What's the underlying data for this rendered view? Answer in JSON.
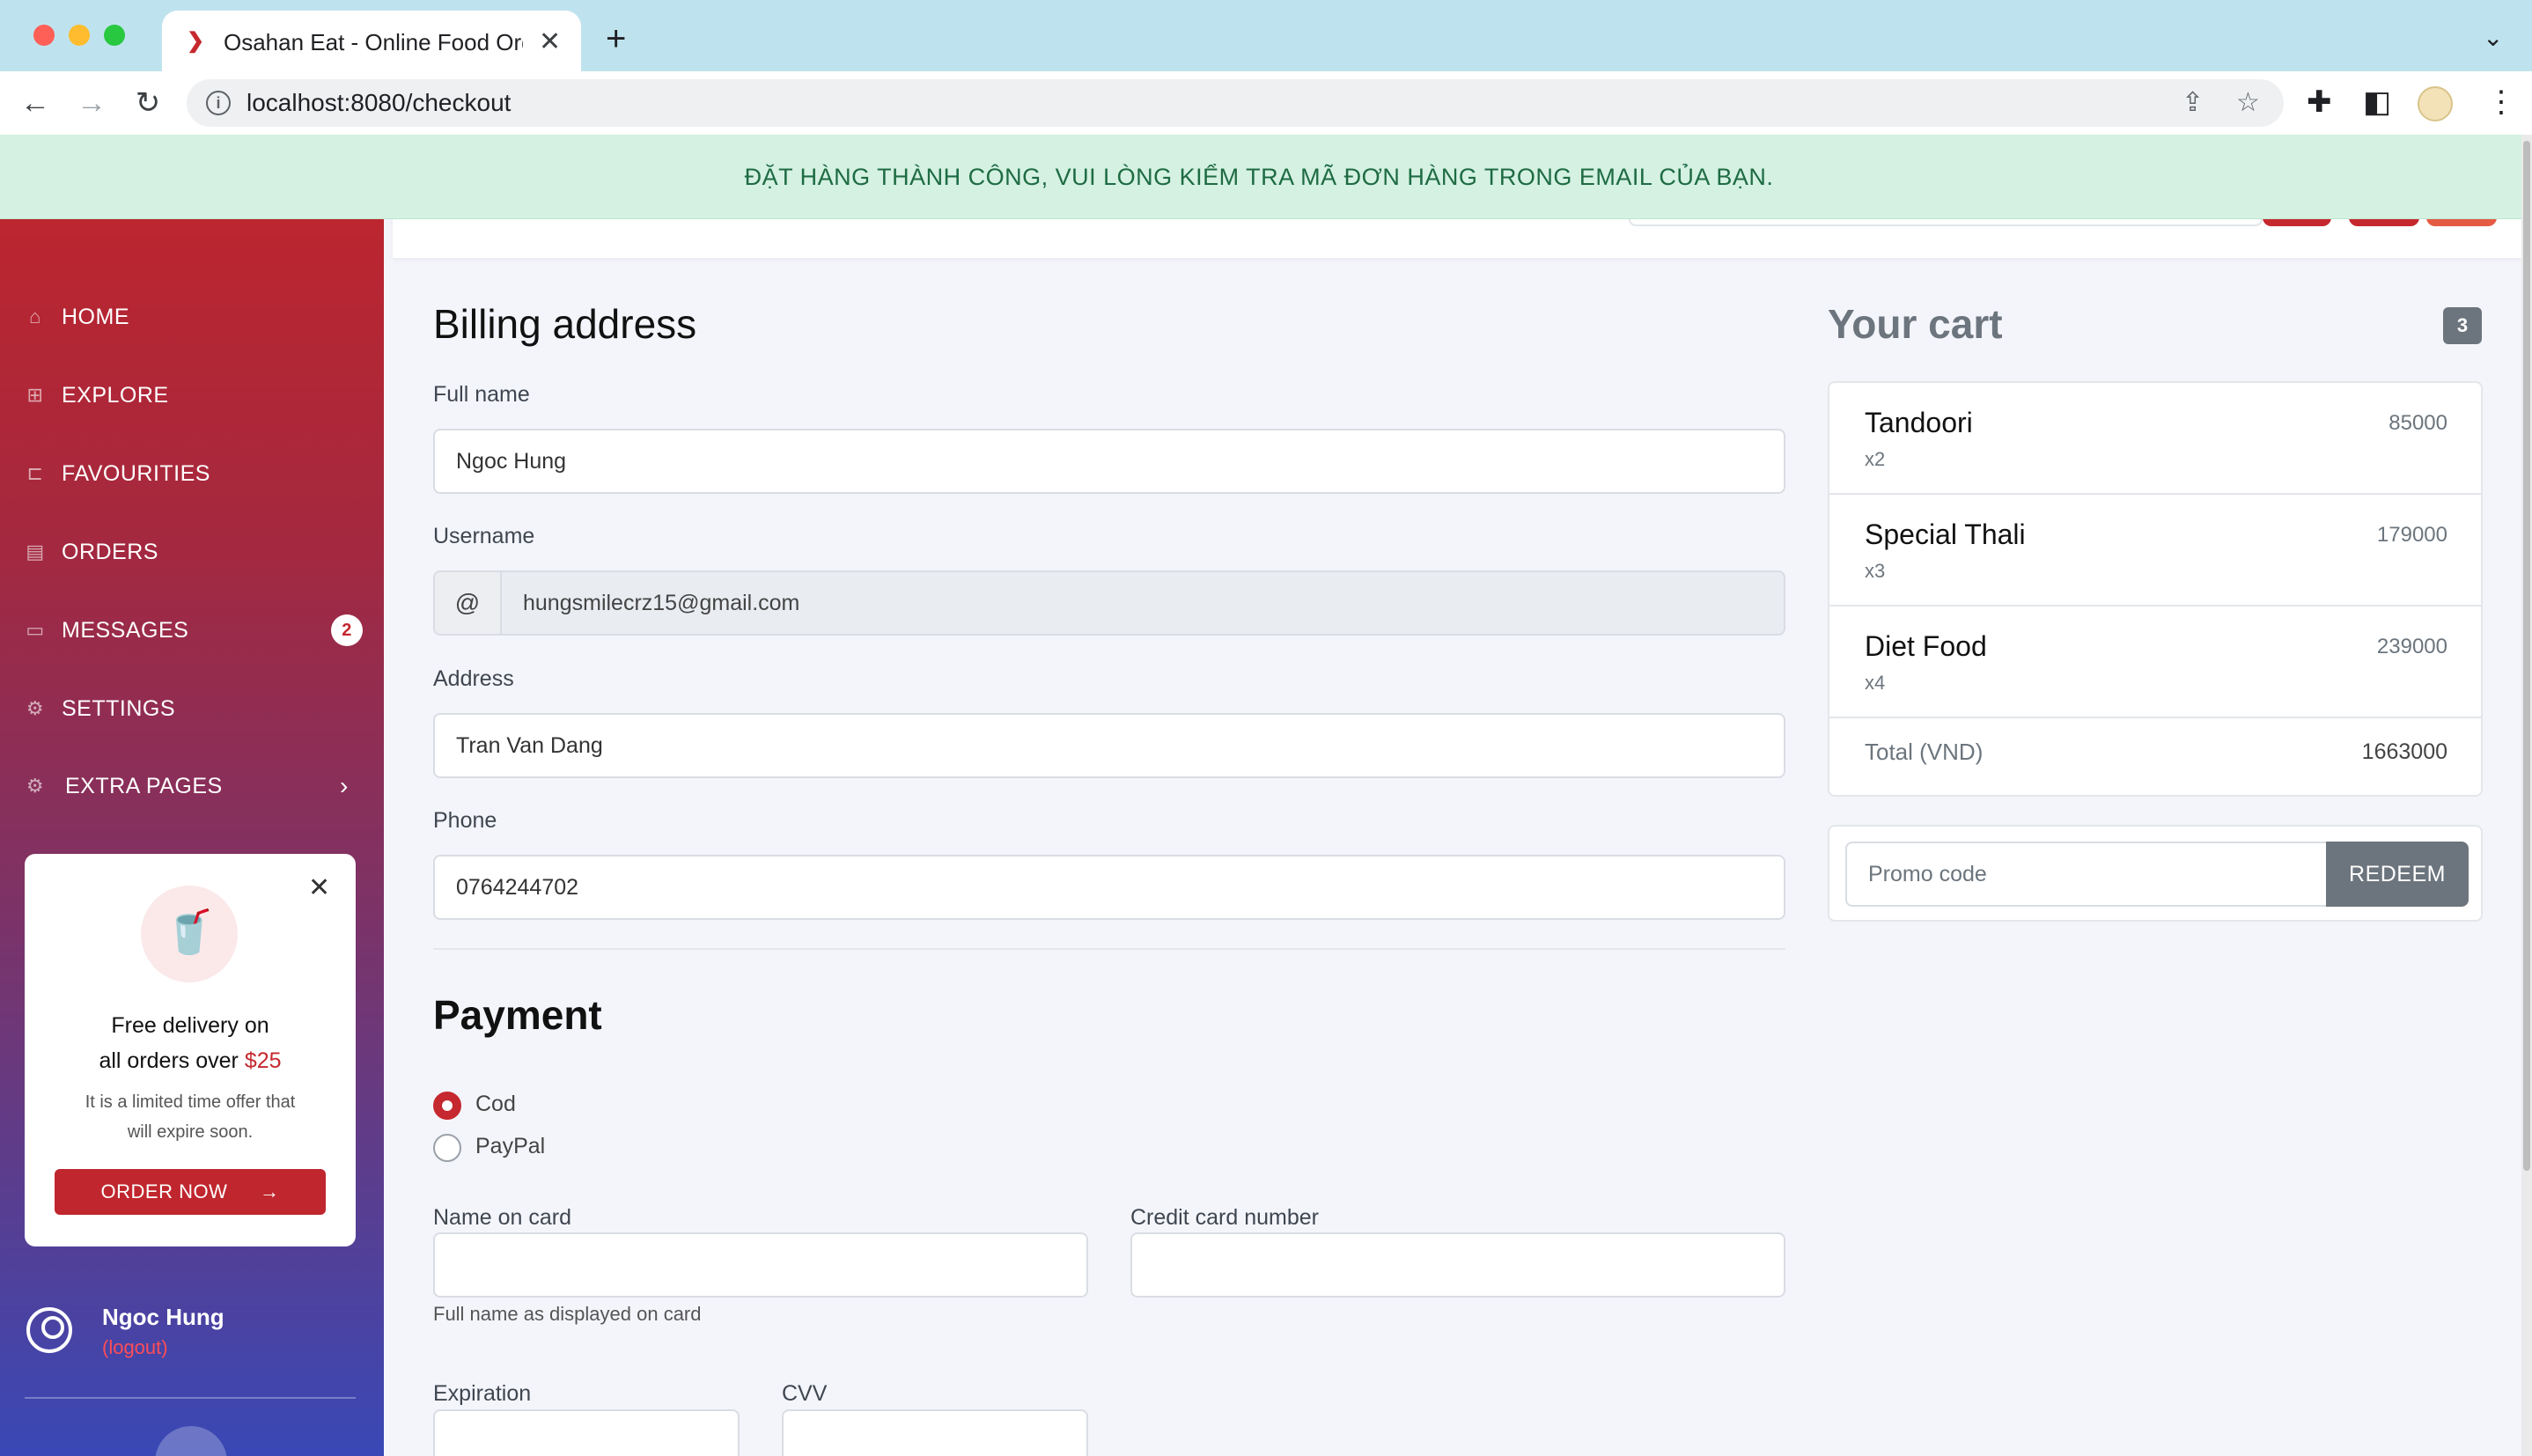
{
  "browser": {
    "tab_title": "Osahan Eat - Online Food Orde",
    "tab_close": "✕",
    "new_tab": "+",
    "url": "localhost:8080/checkout"
  },
  "alert": {
    "message": "ĐẶT HÀNG THÀNH CÔNG, VUI LÒNG KIỂM TRA MÃ ĐƠN HÀNG TRONG EMAIL CỦA BẠN."
  },
  "sidebar": {
    "items": [
      {
        "label": "HOME",
        "icon": "home-icon"
      },
      {
        "label": "EXPLORE",
        "icon": "grid-icon"
      },
      {
        "label": "FAVOURITIES",
        "icon": "bookmark-icon"
      },
      {
        "label": "ORDERS",
        "icon": "orders-icon"
      },
      {
        "label": "MESSAGES",
        "icon": "message-icon",
        "badge": "2"
      },
      {
        "label": "SETTINGS",
        "icon": "gear-icon"
      },
      {
        "label": "EXTRA PAGES",
        "icon": "gear-icon"
      }
    ],
    "promo": {
      "line1": "Free delivery on",
      "line2_prefix": "all orders over ",
      "line2_price": "$25",
      "sub1": "It is a limited time offer that",
      "sub2": "will expire soon.",
      "button": "ORDER NOW",
      "button_arrow": "→"
    },
    "user": {
      "name": "Ngoc Hung",
      "logout": "(logout)"
    }
  },
  "billing": {
    "title": "Billing address",
    "full_name_label": "Full name",
    "full_name_value": "Ngoc Hung",
    "username_label": "Username",
    "username_addon": "@",
    "username_value": "hungsmilecrz15@gmail.com",
    "address_label": "Address",
    "address_value": "Tran Van Dang",
    "phone_label": "Phone",
    "phone_value": "0764244702"
  },
  "payment": {
    "title": "Payment",
    "methods": [
      {
        "label": "Cod",
        "checked": true
      },
      {
        "label": "PayPal",
        "checked": false
      }
    ],
    "name_on_card_label": "Name on card",
    "name_on_card_help": "Full name as displayed on card",
    "card_number_label": "Credit card number",
    "expiration_label": "Expiration",
    "cvv_label": "CVV"
  },
  "cart": {
    "title": "Your cart",
    "count": "3",
    "items": [
      {
        "name": "Tandoori",
        "qty": "x2",
        "price": "85000"
      },
      {
        "name": "Special Thali",
        "qty": "x3",
        "price": "179000"
      },
      {
        "name": "Diet Food",
        "qty": "x4",
        "price": "239000"
      }
    ],
    "total_label": "Total (VND)",
    "total_value": "1663000",
    "promo_placeholder": "Promo code",
    "redeem_label": "REDEEM"
  },
  "colors": {
    "brand": "#c5282e",
    "alert_bg": "#d4f1e2",
    "alert_text": "#1e6b43"
  }
}
